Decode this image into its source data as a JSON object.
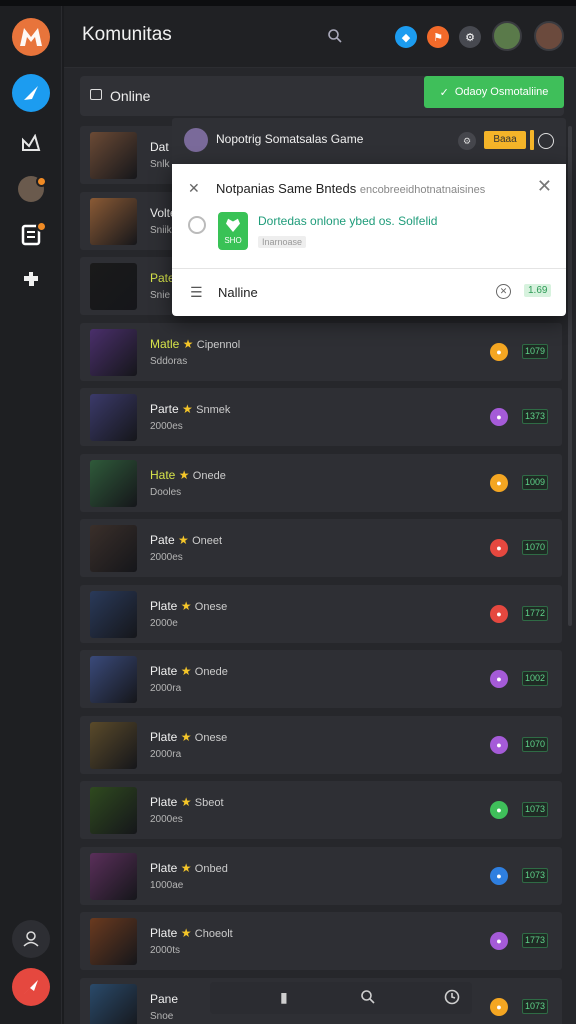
{
  "app": {
    "title": "Komunitas"
  },
  "header": {
    "search_icon": "search-icon",
    "dots": [
      {
        "name": "notification-dot-blue",
        "color": "#1c9cf0",
        "glyph": "◆"
      },
      {
        "name": "notification-dot-orange",
        "color": "#f26a2a",
        "glyph": "⚑"
      },
      {
        "name": "notification-dot-gray",
        "color": "#474950",
        "glyph": "⚙"
      }
    ]
  },
  "online_bar": {
    "label": "Online",
    "button_label": "Odaoy Osmotaliine"
  },
  "popup_header": {
    "title": "Nopotrig Somatsalas Game",
    "badge": "Baaa"
  },
  "popup": {
    "title": "Notpanias Same Bnteds",
    "title_light": "encobreeidhotnatnaisines",
    "description": "Dortedas onlone ybed os. Solfelid",
    "app_label": "SHO",
    "chip": "Inarnoase",
    "menu_label": "Nalline",
    "count": "1.69"
  },
  "items": [
    {
      "name": "Dat",
      "sub": "Snlk",
      "hl": false,
      "extra": "",
      "dot_color": "",
      "count": ""
    },
    {
      "name": "Volte",
      "sub": "Sniik",
      "hl": false,
      "extra": "",
      "dot_color": "",
      "count": ""
    },
    {
      "name": "Pate",
      "sub": "Snie",
      "hl": true,
      "extra": "",
      "dot_color": "",
      "count": ""
    },
    {
      "name": "Matle",
      "sub": "Sddoras",
      "hl": true,
      "extra": "Cipennol",
      "dot_color": "#f4a622",
      "count": "1079"
    },
    {
      "name": "Parte",
      "sub": "2000es",
      "hl": false,
      "extra": "Snmek",
      "dot_color": "#a55bd8",
      "count": "1373"
    },
    {
      "name": "Hate",
      "sub": "Dooles",
      "hl": true,
      "extra": "Onede",
      "dot_color": "#f4a622",
      "count": "1009"
    },
    {
      "name": "Pate",
      "sub": "2000es",
      "hl": false,
      "extra": "Oneet",
      "dot_color": "#e5483f",
      "count": "1070"
    },
    {
      "name": "Plate",
      "sub": "2000e",
      "hl": false,
      "extra": "Onese",
      "dot_color": "#e5483f",
      "count": "1772"
    },
    {
      "name": "Plate",
      "sub": "2000ra",
      "hl": false,
      "extra": "Onede",
      "dot_color": "#a55bd8",
      "count": "1002"
    },
    {
      "name": "Plate",
      "sub": "2000ra",
      "hl": false,
      "extra": "Onese",
      "dot_color": "#a55bd8",
      "count": "1070"
    },
    {
      "name": "Plate",
      "sub": "2000es",
      "hl": false,
      "extra": "Sbeot",
      "dot_color": "#3fbf5a",
      "count": "1073"
    },
    {
      "name": "Plate",
      "sub": "1000ae",
      "hl": false,
      "extra": "Onbed",
      "dot_color": "#2e7fe0",
      "count": "1073"
    },
    {
      "name": "Plate",
      "sub": "2000ts",
      "hl": false,
      "extra": "Choeolt",
      "dot_color": "#a55bd8",
      "count": "1773"
    },
    {
      "name": "Pane",
      "sub": "Snoe",
      "hl": false,
      "extra": "",
      "dot_color": "#f4a622",
      "count": "1073"
    }
  ],
  "colors": {
    "accent_green": "#3fbf5a",
    "sidebar_logo": "#f26a2a",
    "sidebar_bottom": "#e5483f"
  }
}
